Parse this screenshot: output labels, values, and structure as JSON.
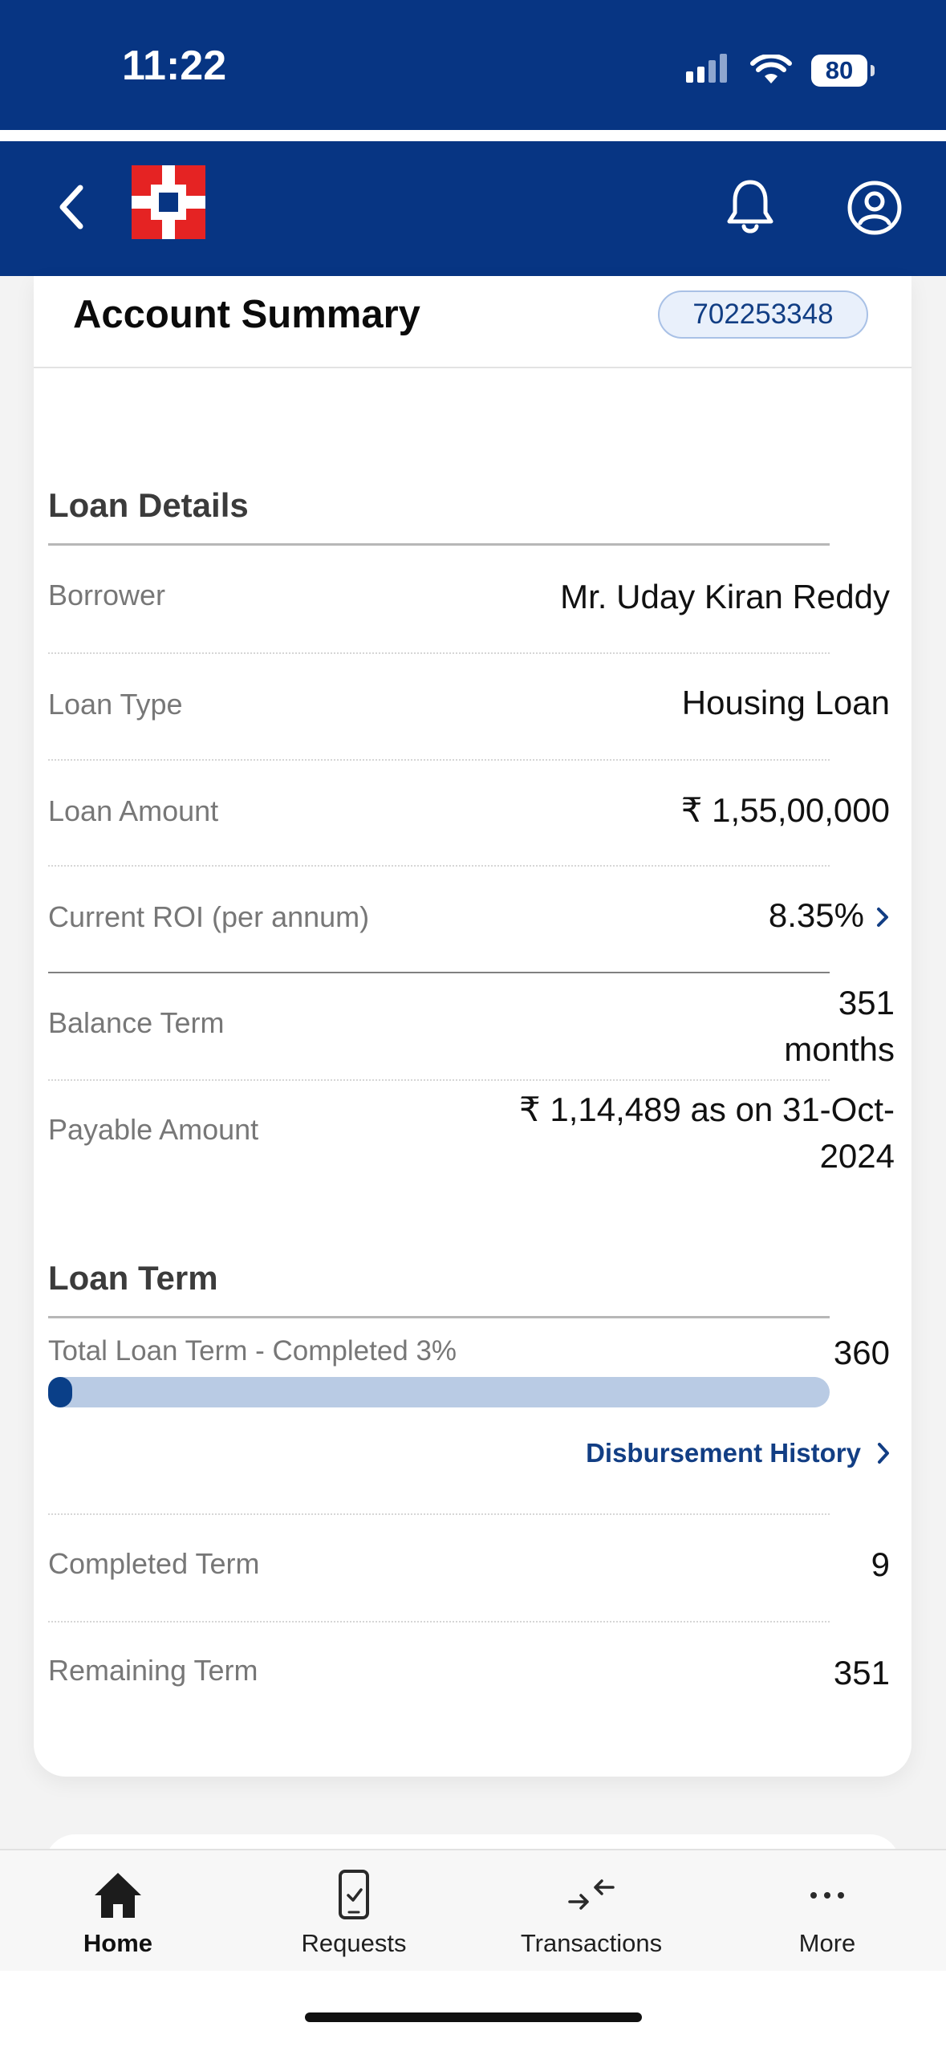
{
  "status": {
    "time": "11:22",
    "battery": "80"
  },
  "header": {
    "back_icon": "chevron-left-icon",
    "logo": "bank-logo",
    "notifications_icon": "bell-icon",
    "profile_icon": "user-circle-icon",
    "colors": {
      "brand_blue": "#073583",
      "logo_red": "#e52323"
    }
  },
  "account_summary": {
    "title": "Account Summary",
    "account_number": "702253348"
  },
  "loan_details": {
    "heading": "Loan Details",
    "rows": [
      {
        "label": "Borrower",
        "value": "Mr. Uday Kiran Reddy"
      },
      {
        "label": "Loan Type",
        "value": "Housing Loan"
      },
      {
        "label": "Loan Amount",
        "value": "₹ 1,55,00,000"
      },
      {
        "label": "Current ROI (per annum)",
        "value": "8.35%"
      },
      {
        "label": "Balance Term",
        "value_line1": "351",
        "value_line2": "months"
      },
      {
        "label": "Payable Amount",
        "value_line1": "₹ 1,14,489 as on 31-Oct-",
        "value_line2": "2024"
      }
    ]
  },
  "loan_term": {
    "heading": "Loan Term",
    "progress_label": "Total Loan Term - Completed 3%",
    "total_value": "360",
    "progress_fraction": 0.03,
    "disbursement_link": "Disbursement History",
    "rows": [
      {
        "label": "Completed Term",
        "value": "9"
      },
      {
        "label": "Remaining Term",
        "value": "351"
      }
    ]
  },
  "tabbar": {
    "items": [
      {
        "label": "Home",
        "icon": "home-icon"
      },
      {
        "label": "Requests",
        "icon": "phone-check-icon"
      },
      {
        "label": "Transactions",
        "icon": "transfer-arrows-icon"
      },
      {
        "label": "More",
        "icon": "more-dots-icon"
      }
    ]
  }
}
